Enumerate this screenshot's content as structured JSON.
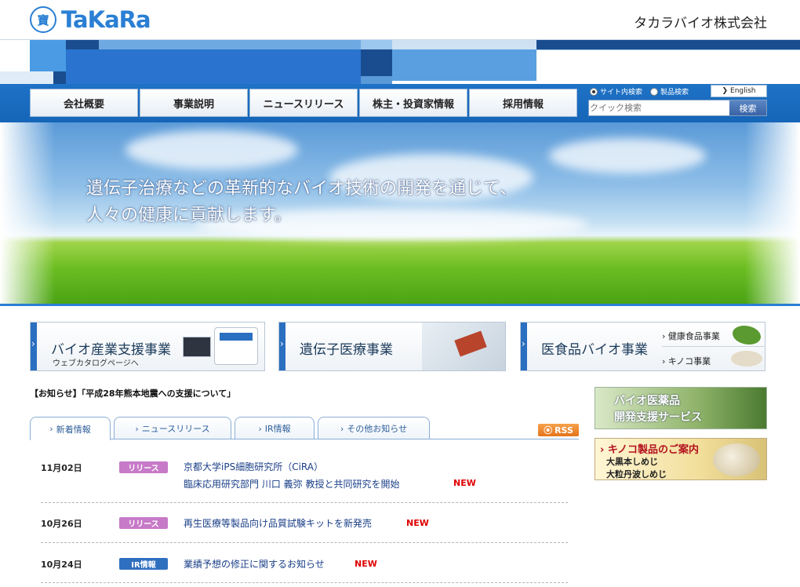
{
  "header": {
    "logo_mark": "寶",
    "logo_text": "TaKaRa",
    "company_name": "タカラバイオ株式会社"
  },
  "nav": {
    "items": [
      "会社概要",
      "事業説明",
      "ニュースリリース",
      "株主・投資家情報",
      "採用情報"
    ]
  },
  "search": {
    "radio_site": "サイト内検索",
    "radio_product": "製品検索",
    "english": "English",
    "placeholder": "クイック検索",
    "button": "検索"
  },
  "hero": {
    "line1": "遺伝子治療などの革新的なバイオ技術の開発を通じて、",
    "line2": "人々の健康に貢献します。"
  },
  "banners": {
    "bio": {
      "title": "バイオ産業支援事業",
      "sub": "ウェブカタログページへ"
    },
    "gene": {
      "title": "遺伝子医療事業"
    },
    "food": {
      "title": "医食品バイオ事業",
      "link1": "健康食品事業",
      "link2": "キノコ事業"
    }
  },
  "notice": "【お知らせ】「平成28年熊本地震への支援について」",
  "tabs": [
    "新着情報",
    "ニュースリリース",
    "IR情報",
    "その他お知らせ"
  ],
  "rss": "RSS",
  "news": [
    {
      "date": "11月02日",
      "badge": "リリース",
      "line1": "京都大学iPS細胞研究所（CiRA）",
      "line2": "臨床応用研究部門 川口 義弥 教授と共同研究を開始",
      "new": "NEW"
    },
    {
      "date": "10月26日",
      "badge": "リリース",
      "line1": "再生医療等製品向け品質試験キットを新発売",
      "new": "NEW"
    },
    {
      "date": "10月24日",
      "badge": "IR情報",
      "line1": "業績予想の修正に関するお知らせ",
      "new": "NEW"
    }
  ],
  "side": {
    "banner1_line1": "バイオ医薬品",
    "banner1_line2": "開発支援サービス",
    "banner2_line1": "キノコ製品のご案内",
    "banner2_line2": "大黒本しめじ",
    "banner2_line3": "大粒丹波しめじ"
  },
  "colors": {
    "brand_blue": "#2a7fd4",
    "nav_blue": "#1565b8",
    "new_red": "#e00000",
    "release_badge": "#c77ac8",
    "ir_badge": "#2f6fc0"
  }
}
